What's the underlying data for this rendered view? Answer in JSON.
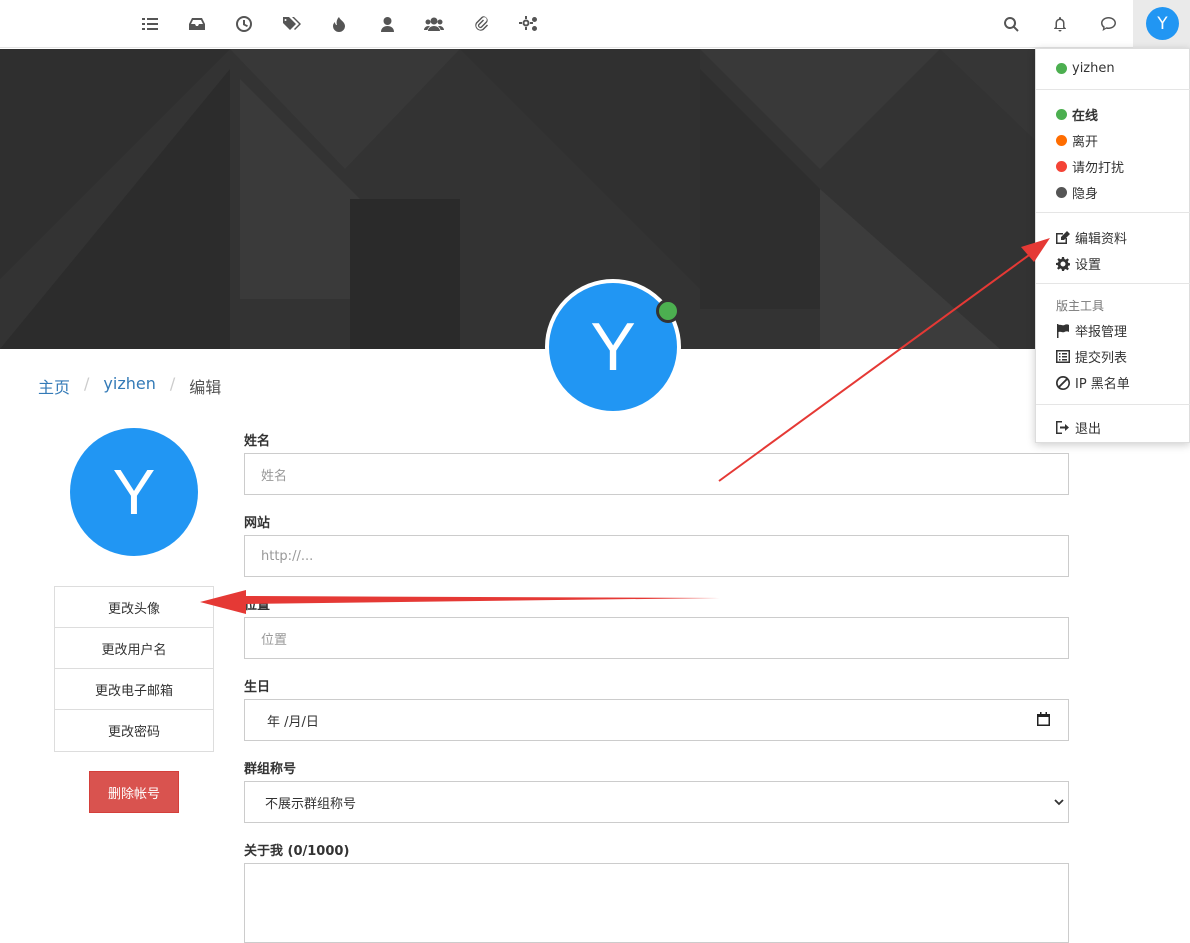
{
  "topbar": {
    "nav_icons": [
      "list-icon",
      "inbox-icon",
      "clock-icon",
      "tags-icon",
      "fire-icon",
      "user-icon",
      "users-icon",
      "paperclip-icon",
      "cogs-icon"
    ],
    "avatar_letter": "Y"
  },
  "profile": {
    "avatar_letter": "Y",
    "status_color": "#4caf50"
  },
  "breadcrumb": {
    "home": "主页",
    "user": "yizhen",
    "current": "编辑"
  },
  "sidebar": {
    "avatar_letter": "Y",
    "items": [
      {
        "label": "更改头像"
      },
      {
        "label": "更改用户名"
      },
      {
        "label": "更改电子邮箱"
      },
      {
        "label": "更改密码"
      }
    ],
    "delete_label": "删除帐号"
  },
  "form": {
    "fullname": {
      "label": "姓名",
      "placeholder": "姓名"
    },
    "website": {
      "label": "网站",
      "placeholder": "http://..."
    },
    "location": {
      "label": "位置",
      "placeholder": "位置"
    },
    "birthday": {
      "label": "生日",
      "value": "年 /月/日"
    },
    "group_title": {
      "label": "群组称号",
      "value": "不展示群组称号"
    },
    "aboutme": {
      "label": "关于我 (0/1000)"
    }
  },
  "dropdown": {
    "username": "yizhen",
    "status": [
      {
        "label": "在线",
        "color": "#4caf50"
      },
      {
        "label": "离开",
        "color": "#ff6d00"
      },
      {
        "label": "请勿打扰",
        "color": "#f44336"
      },
      {
        "label": "隐身",
        "color": "#555555"
      }
    ],
    "edit_profile": "编辑资料",
    "settings": "设置",
    "mod_tools_header": "版主工具",
    "flags": "举报管理",
    "post_queue": "提交列表",
    "ip_blacklist": "IP 黑名单",
    "logout": "退出"
  },
  "colors": {
    "accent": "#2196f3",
    "danger": "#d9534f",
    "link": "#337ab7",
    "arrow": "#e53935"
  }
}
